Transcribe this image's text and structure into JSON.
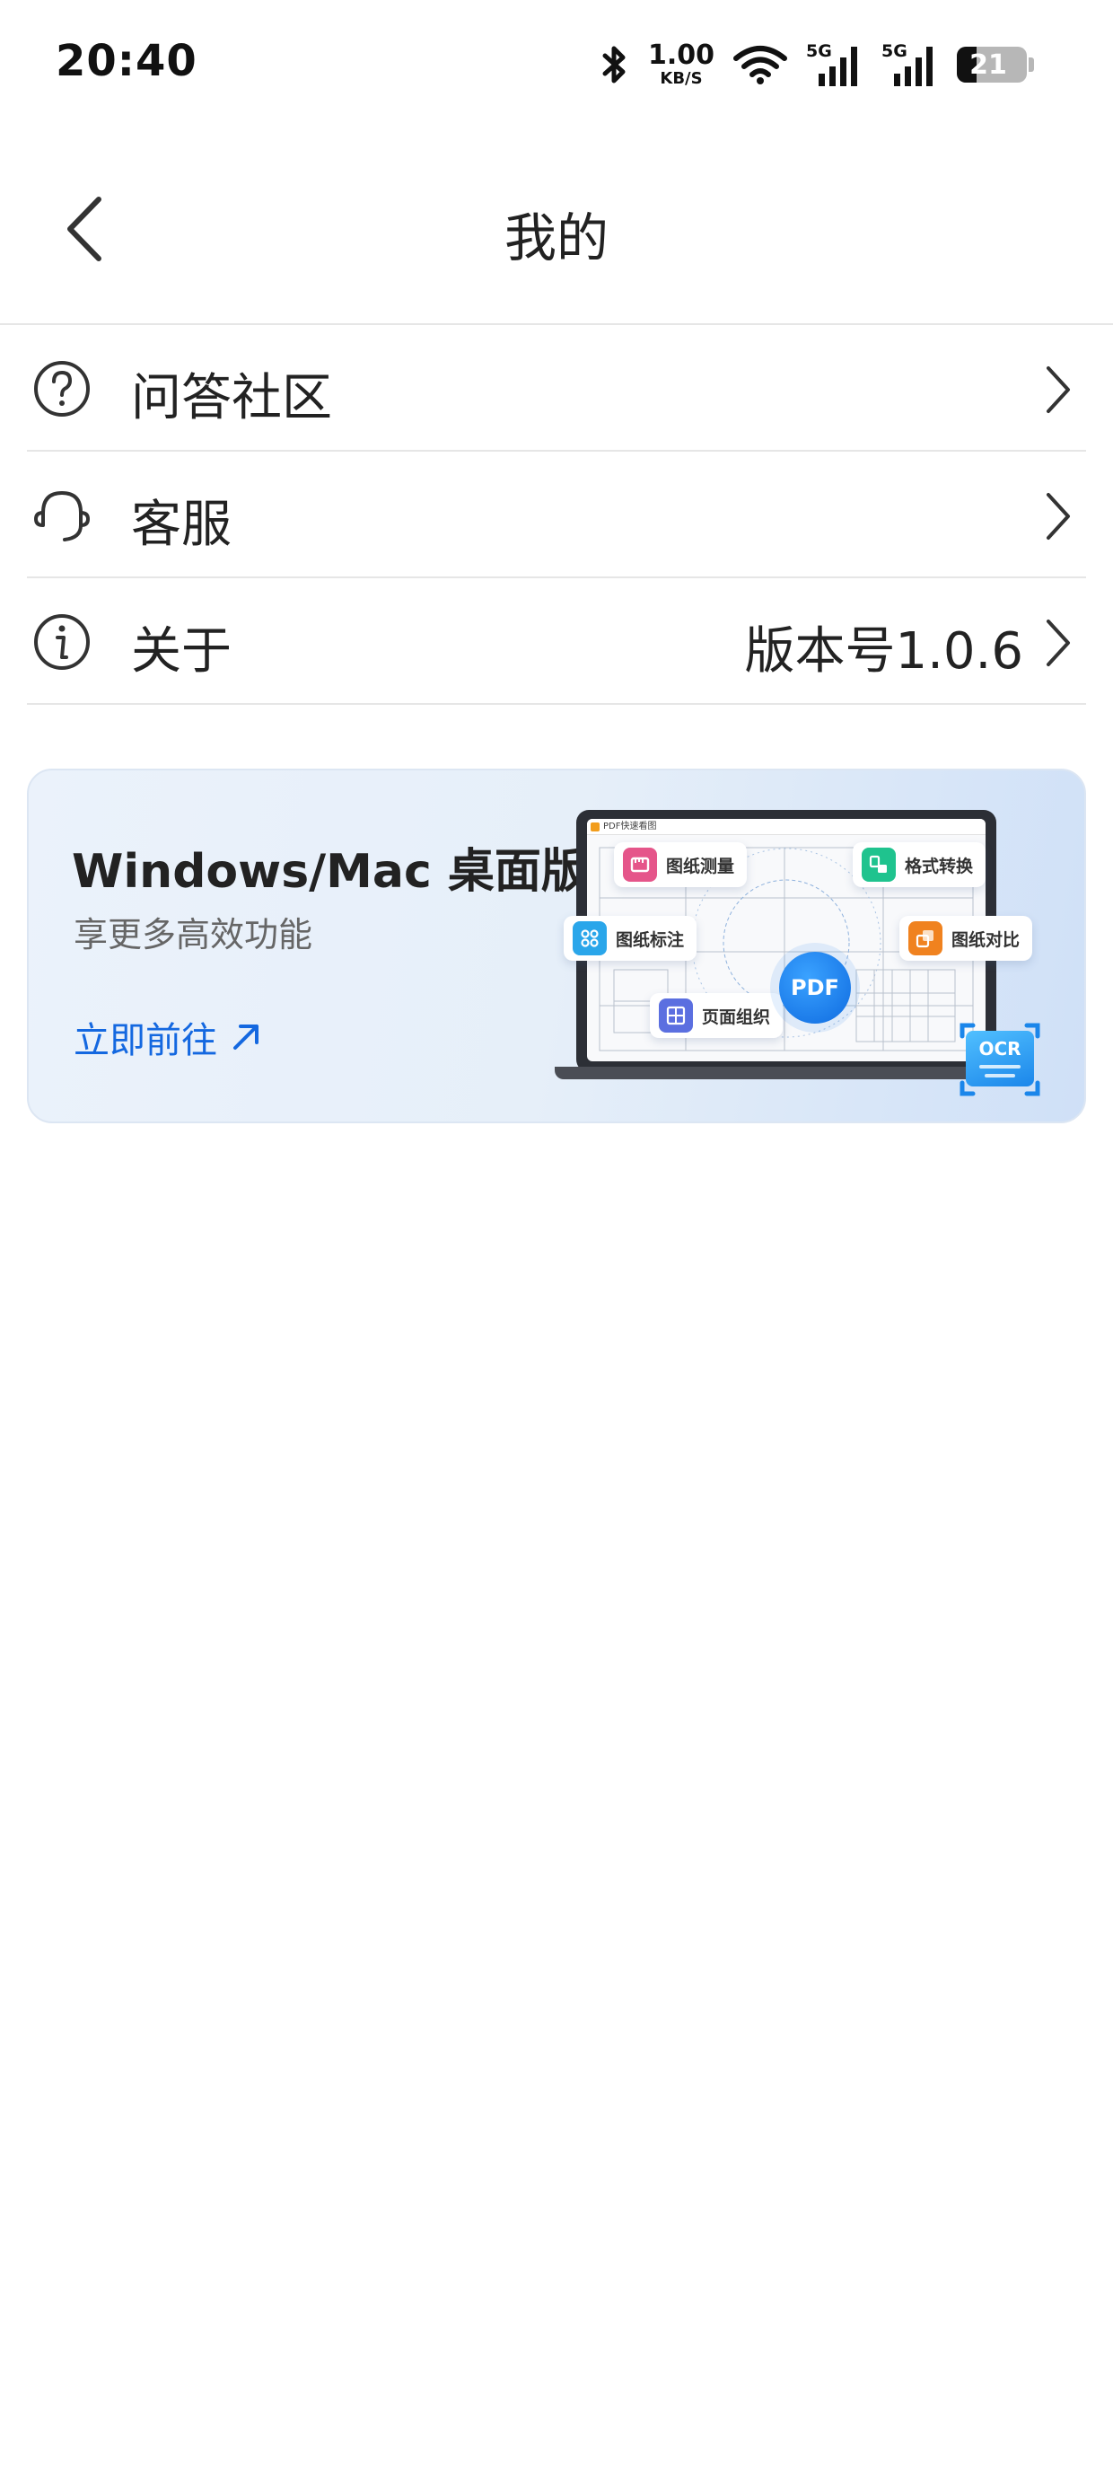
{
  "status_bar": {
    "time": "20:40",
    "net_speed_value": "1.00",
    "net_speed_unit": "KB/S",
    "sim1_tag": "5G",
    "sim2_tag": "5G",
    "battery_level": "21",
    "icons": [
      "bluetooth-icon",
      "wifi-icon",
      "cell-signal-icon",
      "cell-signal-icon",
      "battery-icon"
    ]
  },
  "nav": {
    "title": "我的",
    "back_icon": "chevron-left-icon"
  },
  "menu": {
    "items": [
      {
        "label": "问答社区",
        "icon": "question-circle-icon",
        "value": ""
      },
      {
        "label": "客服",
        "icon": "headset-icon",
        "value": ""
      },
      {
        "label": "关于",
        "icon": "info-circle-icon",
        "value": "版本号1.0.6"
      }
    ]
  },
  "promo": {
    "title": "Windows/Mac 桌面版",
    "subtitle": "享更多高效功能",
    "cta": "立即前往",
    "illustration": {
      "app_name": "PDF快速看图",
      "center_badge": "PDF",
      "ocr_badge": "OCR",
      "features": [
        {
          "label": "图纸测量",
          "color": "#e5558a"
        },
        {
          "label": "格式转换",
          "color": "#1fc38e"
        },
        {
          "label": "图纸标注",
          "color": "#2aa6ea"
        },
        {
          "label": "图纸对比",
          "color": "#f0821f"
        },
        {
          "label": "页面组织",
          "color": "#5b6fe0"
        }
      ]
    }
  },
  "colors": {
    "accent": "#1468e0",
    "divider": "#e6e6e6",
    "text_primary": "#222222",
    "text_secondary": "#666666"
  }
}
